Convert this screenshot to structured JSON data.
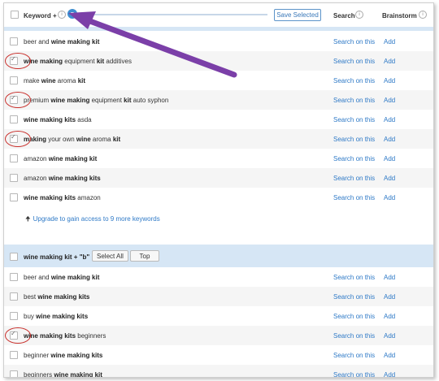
{
  "header": {
    "keyword_label": "Keyword +",
    "save_label": "Save Selected",
    "search_label": "Search",
    "brainstorm_label": "Brainstorm"
  },
  "rows": [
    {
      "pre": "beer and ",
      "bold": "wine making kit",
      "post": "",
      "checked": false,
      "alt": false,
      "circled": false,
      "search": "Search on this",
      "add": "Add"
    },
    {
      "pre": "",
      "bold": "wine making",
      "post": " equipment ",
      "bold2": "kit",
      "post2": " additives",
      "checked": true,
      "alt": true,
      "circled": true,
      "search": "Search on this",
      "add": "Add"
    },
    {
      "pre": "make ",
      "bold": "wine",
      "post": " aroma ",
      "bold2": "kit",
      "post2": "",
      "checked": false,
      "alt": false,
      "circled": false,
      "search": "Search on this",
      "add": "Add"
    },
    {
      "pre": "premium ",
      "bold": "wine making",
      "post": " equipment ",
      "bold2": "kit",
      "post2": " auto syphon",
      "checked": true,
      "alt": true,
      "circled": true,
      "search": "Search on this",
      "add": "Add"
    },
    {
      "pre": "",
      "bold": "wine making kits",
      "post": " asda",
      "checked": false,
      "alt": false,
      "circled": false,
      "search": "Search on this",
      "add": "Add"
    },
    {
      "pre": "",
      "bold": "making",
      "post": " your own ",
      "bold2": "wine",
      "post2": " aroma ",
      "bold3": "kit",
      "checked": true,
      "alt": true,
      "circled": true,
      "search": "Search on this",
      "add": "Add"
    },
    {
      "pre": "amazon ",
      "bold": "wine making kit",
      "post": "",
      "checked": false,
      "alt": false,
      "circled": false,
      "search": "Search on this",
      "add": "Add"
    },
    {
      "pre": "amazon ",
      "bold": "wine making kits",
      "post": "",
      "checked": false,
      "alt": true,
      "circled": false,
      "search": "Search on this",
      "add": "Add"
    },
    {
      "pre": "",
      "bold": "wine making kits",
      "post": " amazon",
      "checked": false,
      "alt": false,
      "circled": false,
      "search": "Search on this",
      "add": "Add"
    }
  ],
  "upgrade_text": "Upgrade to gain access to 9 more keywords",
  "group": {
    "title": "wine making kit + \"b\"",
    "select_all": "Select All",
    "top": "Top"
  },
  "group_rows": [
    {
      "pre": "beer and ",
      "bold": "wine making kit",
      "post": "",
      "checked": false,
      "alt": false,
      "circled": false,
      "search": "Search on this",
      "add": "Add"
    },
    {
      "pre": "best ",
      "bold": "wine making kits",
      "post": "",
      "checked": false,
      "alt": true,
      "circled": false,
      "search": "Search on this",
      "add": "Add"
    },
    {
      "pre": "buy ",
      "bold": "wine making kits",
      "post": "",
      "checked": false,
      "alt": false,
      "circled": false,
      "search": "Search on this",
      "add": "Add"
    },
    {
      "pre": "",
      "bold": "wine making kits",
      "post": " beginners",
      "checked": true,
      "alt": true,
      "circled": true,
      "search": "Search on this",
      "add": "Add"
    },
    {
      "pre": "beginner ",
      "bold": "wine making kits",
      "post": "",
      "checked": false,
      "alt": false,
      "circled": false,
      "search": "Search on this",
      "add": "Add"
    },
    {
      "pre": "beginners ",
      "bold": "wine making kit",
      "post": "",
      "checked": false,
      "alt": true,
      "circled": false,
      "search": "Search on this",
      "add": "Add"
    }
  ],
  "colors": {
    "accent": "#2f7ac7",
    "annotation_arrow": "#7b3fa8",
    "annotation_circle": "#c9302c"
  },
  "icons": {
    "info": "info-icon",
    "lock": "lock-icon",
    "upgrade_arrow": "up-arrow-icon"
  }
}
